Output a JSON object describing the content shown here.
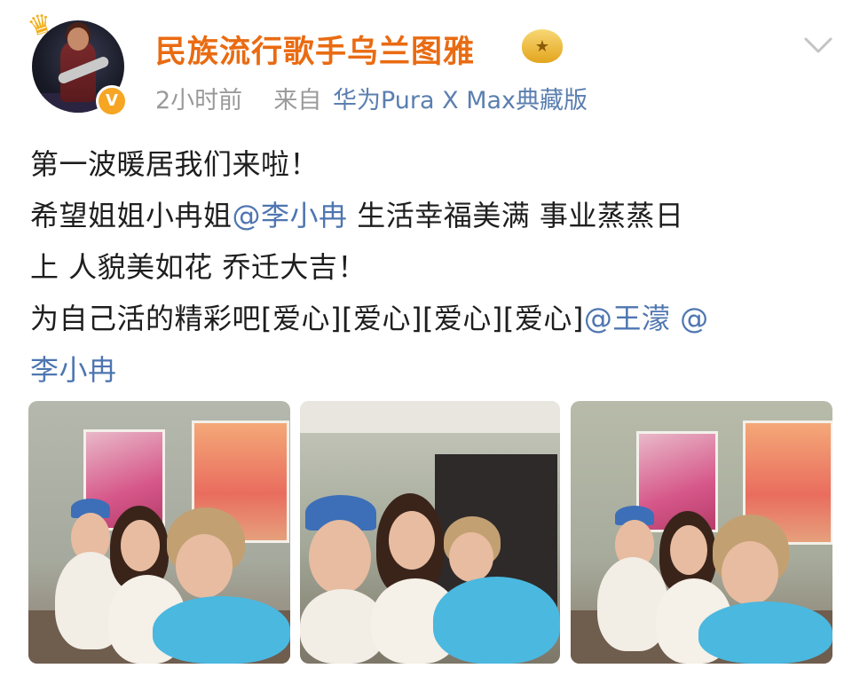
{
  "post": {
    "author_name": "民族流行歌手乌兰图雅",
    "time": "2小时前",
    "source_prefix": "来自",
    "source_device": "华为Pura X Max典藏版",
    "verified_badge": "V",
    "vip_badge": "★",
    "lines": [
      [
        {
          "t": "第一波暖居我们来啦！",
          "m": false
        }
      ],
      [
        {
          "t": "希望姐姐小冉姐",
          "m": false
        },
        {
          "t": "@李小冉",
          "m": true
        },
        {
          "t": " 生活幸福美满 事业蒸蒸日",
          "m": false
        }
      ],
      [
        {
          "t": "上 人貌美如花 乔迁大吉！",
          "m": false
        }
      ],
      [
        {
          "t": "为自己活的精彩吧[爱心][爱心][爱心][爱心]",
          "m": false
        },
        {
          "t": "@王濛",
          "m": true
        },
        {
          "t": " @",
          "m": true
        }
      ],
      [
        {
          "t": "李小冉",
          "m": true
        }
      ]
    ]
  },
  "photos": [
    {
      "name": "photo-1"
    },
    {
      "name": "photo-2"
    },
    {
      "name": "photo-3"
    }
  ],
  "colors": {
    "name": "#e96b12",
    "mention": "#4e76b0",
    "meta": "#9a9a9a",
    "verified": "#f6a623"
  }
}
